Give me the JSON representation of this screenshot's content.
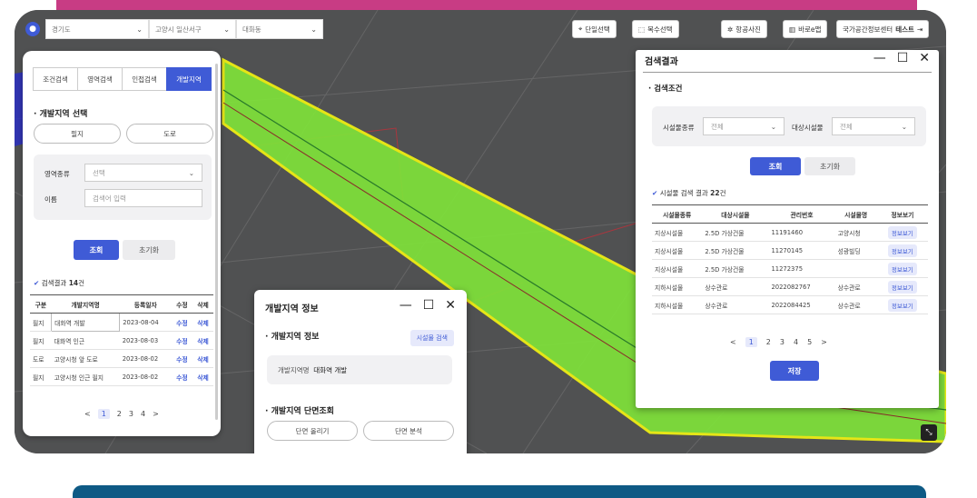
{
  "top": {
    "selects": [
      {
        "value": "경기도",
        "w": 0
      },
      {
        "value": "고양시 일산서구"
      },
      {
        "value": "대화동"
      }
    ],
    "buttons": {
      "single": "단일선택",
      "multi": "복수선택",
      "aerial": "항공사진",
      "basemap": "바로e맵",
      "center": "국가공간정보센터",
      "test": "테스트"
    }
  },
  "left": {
    "tabs": [
      "조건검색",
      "영역검색",
      "인접검색",
      "개발지역"
    ],
    "active_tab": 3,
    "section": "개발지역 선택",
    "options": [
      "필지",
      "도로"
    ],
    "form": {
      "area_label": "영역종류",
      "area_value": "선택",
      "name_label": "이름",
      "name_placeholder": "검색어 입력"
    },
    "search": "조회",
    "reset": "초기화",
    "result_prefix": "검색결과",
    "result_count": "14",
    "result_suffix": "건",
    "columns": [
      "구분",
      "개발지역명",
      "등록일자",
      "수정",
      "삭제"
    ],
    "rows": [
      {
        "type": "필지",
        "name": "대화역 개발",
        "date": "2023-08-04",
        "edit": "수정",
        "del": "삭제"
      },
      {
        "type": "필지",
        "name": "대화역 인근",
        "date": "2023-08-03",
        "edit": "수정",
        "del": "삭제"
      },
      {
        "type": "도로",
        "name": "고양시청 앞 도로",
        "date": "2023-08-02",
        "edit": "수정",
        "del": "삭제"
      },
      {
        "type": "필지",
        "name": "고양시청 인근 필지",
        "date": "2023-08-02",
        "edit": "수정",
        "del": "삭제"
      }
    ],
    "pages": [
      "1",
      "2",
      "3",
      "4"
    ]
  },
  "dev": {
    "title": "개발지역 정보",
    "section1": "개발지역 정보",
    "facility_search": "시설물 검색",
    "name_label": "개발지역명",
    "name_value": "대화역 개발",
    "section2": "개발지역 단면조회",
    "btn1": "단면 올리기",
    "btn2": "단면 분석"
  },
  "result": {
    "title": "검색결과",
    "section": "검색조건",
    "f1_label": "시설물종류",
    "f1_value": "전체",
    "f2_label": "대상시설물",
    "f2_value": "전체",
    "search": "조회",
    "reset": "초기화",
    "summary_prefix": "시설물 검색 결과",
    "summary_count": "22",
    "summary_suffix": "건",
    "columns": [
      "시설물종류",
      "대상시설물",
      "관리번호",
      "시설물명",
      "정보보기"
    ],
    "rows": [
      {
        "kind": "지상시설물",
        "target": "2.5D 가상건물",
        "id": "11191460",
        "name": "고양시청",
        "view": "정보보기"
      },
      {
        "kind": "지상시설물",
        "target": "2.5D 가상건물",
        "id": "11270145",
        "name": "성광빌딩",
        "view": "정보보기"
      },
      {
        "kind": "지상시설물",
        "target": "2.5D 가상건물",
        "id": "11272375",
        "name": "",
        "view": "정보보기"
      },
      {
        "kind": "지하시설물",
        "target": "상수관로",
        "id": "2022082767",
        "name": "상수관로",
        "view": "정보보기"
      },
      {
        "kind": "지하시설물",
        "target": "상수관로",
        "id": "2022084425",
        "name": "상수관로",
        "view": "정보보기"
      }
    ],
    "pages": [
      "1",
      "2",
      "3",
      "4",
      "5"
    ],
    "save": "저장"
  },
  "colors": {
    "accent": "#3f5bd6",
    "highlight": "#7fe23a",
    "outline": "#f2f212",
    "brand_top": "#c83c84",
    "brand_bottom": "#0e5a85"
  }
}
